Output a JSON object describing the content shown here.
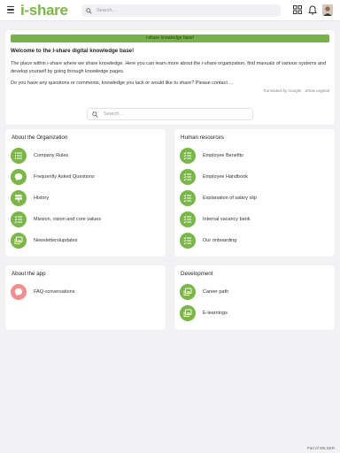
{
  "header": {
    "logo": "i-share",
    "search_placeholder": "Search..."
  },
  "welcome": {
    "banner": "i-share knowledge base!",
    "title": "Welcome to the I-share digital knowledge base!",
    "paragraph1": "The place within i-share where we share knowledge. Here you can learn more about the i-share organization, find manuals of various systems and develop yourself by going through knowledge pages.",
    "paragraph2": "Do you have any questions or comments, knowledge you lack or would like to share? Please contact ...",
    "translated": "Translated by Google - Show original"
  },
  "search": {
    "placeholder": "Search..."
  },
  "sections": {
    "organization": {
      "title": "About the Organization",
      "items": [
        "Company Rules",
        "Frequently Asked Questions",
        "History",
        "Mission, vision and core values",
        "Newsletterslupdates"
      ]
    },
    "hr": {
      "title": "Human resources",
      "items": [
        "Employee Benefits",
        "Employee Handbook",
        "Explanation of salary slip",
        "Internal vacancy bank",
        "Our onboarding"
      ]
    },
    "app": {
      "title": "About the app",
      "items": [
        "FAQ conversations"
      ]
    },
    "development": {
      "title": "Development",
      "items": [
        "Career path",
        "E-learnings"
      ]
    }
  },
  "footer": {
    "text": "Part of WILDER"
  },
  "colors": {
    "brand": "#7ab648",
    "pink": "#ef8f8f",
    "background": "#f2f2f4"
  }
}
